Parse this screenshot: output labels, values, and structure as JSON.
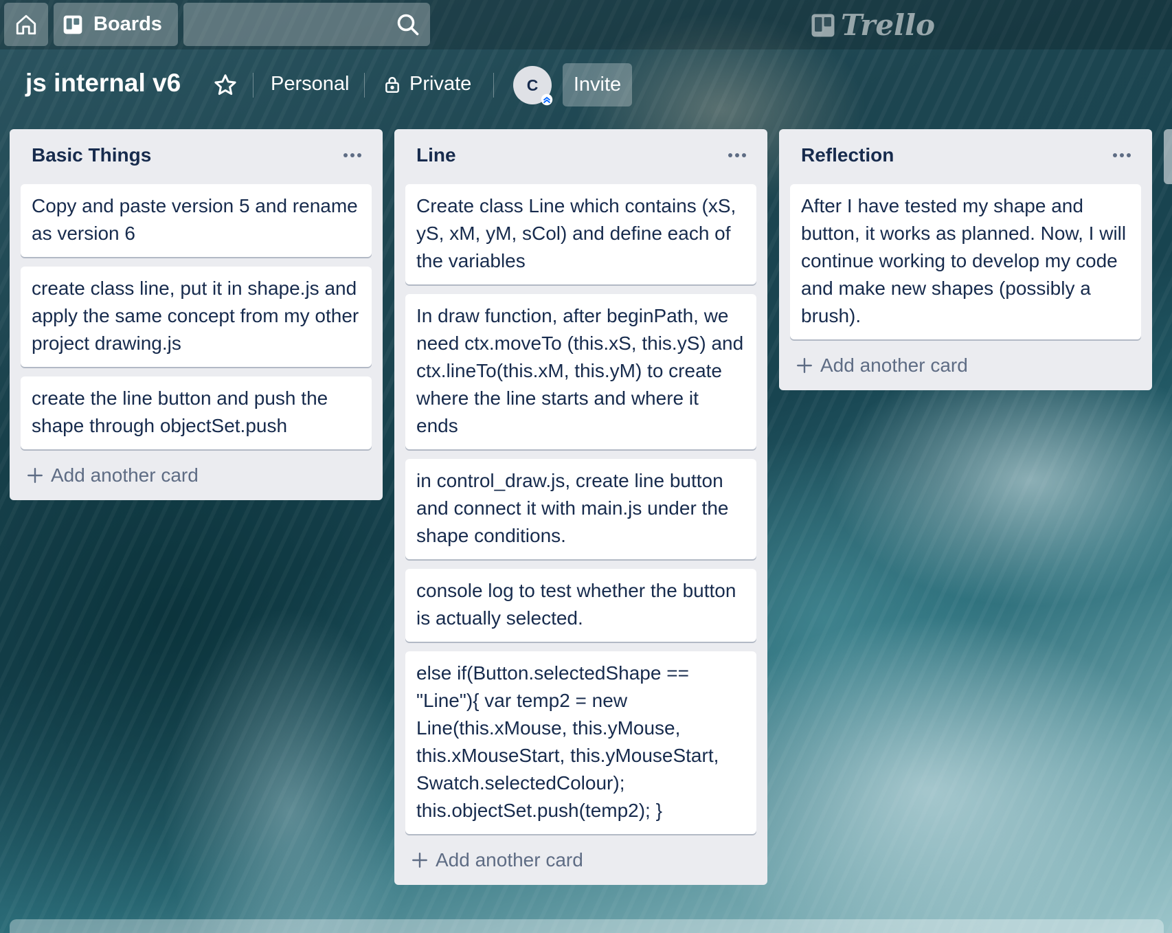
{
  "topnav": {
    "home_icon": "home-icon",
    "boards_icon": "boards-icon",
    "boards_label": "Boards",
    "search_placeholder": "",
    "search_icon": "search-icon",
    "logo_text": "Trello"
  },
  "board": {
    "title": "js internal v6",
    "star_icon": "star-icon",
    "team": "Personal",
    "visibility": "Private",
    "lock_icon": "lock-icon",
    "avatar_initial": "C",
    "invite_label": "Invite"
  },
  "lists": [
    {
      "title": "Basic Things",
      "cards": [
        "Copy and paste version 5 and rename as version 6",
        "create class line, put it in shape.js and apply the same concept from my other project drawing.js",
        "create the line button and push the shape through objectSet.push"
      ],
      "add_label": "Add another card"
    },
    {
      "title": "Line",
      "cards": [
        "Create class Line which contains (xS, yS, xM, yM, sCol) and define each of the variables",
        "In draw function, after beginPath, we need ctx.moveTo (this.xS, this.yS) and ctx.lineTo(this.xM, this.yM) to create where the line starts and where it ends",
        "in control_draw.js, create line button and connect it with main.js under the shape conditions.",
        "console log to test whether the button is actually selected.",
        "else if(Button.selectedShape == \"Line\"){ var temp2 = new Line(this.xMouse, this.yMouse, this.xMouseStart, this.yMouseStart, Swatch.selectedColour); this.objectSet.push(temp2); }"
      ],
      "add_label": "Add another card"
    },
    {
      "title": "Reflection",
      "cards": [
        "After I have tested my shape and button, it works as planned. Now, I will continue working to develop my code and make new shapes (possibly a brush)."
      ],
      "add_label": "Add another card"
    }
  ],
  "colors": {
    "list_bg": "#ebecf0",
    "card_text": "#172b4d",
    "muted_text": "#5e6c84"
  }
}
